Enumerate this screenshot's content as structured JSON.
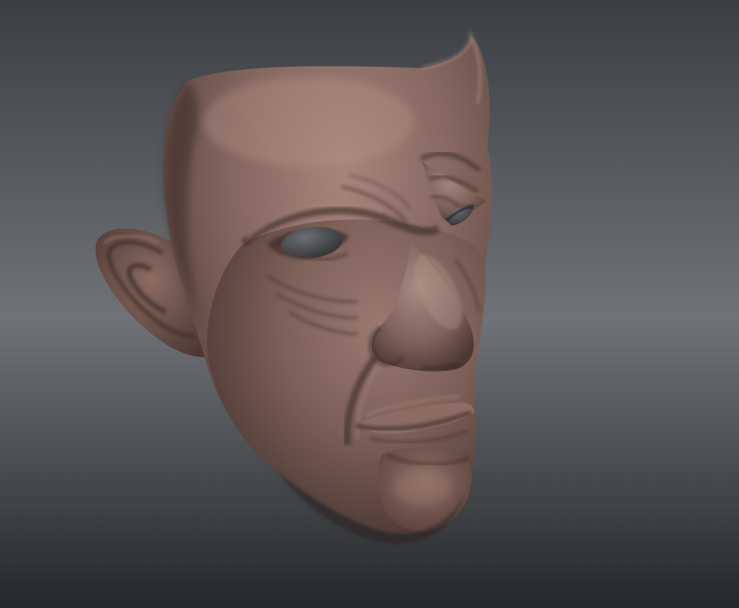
{
  "scene": {
    "background_top": "#3b3e42",
    "background_mid": "#6f7377",
    "background_bottom": "#26282a",
    "clay_base": "#7a5f58",
    "clay_light": "#a6857c",
    "clay_shadow": "#3f2e2a",
    "eye_color": "#4a4c4f"
  }
}
